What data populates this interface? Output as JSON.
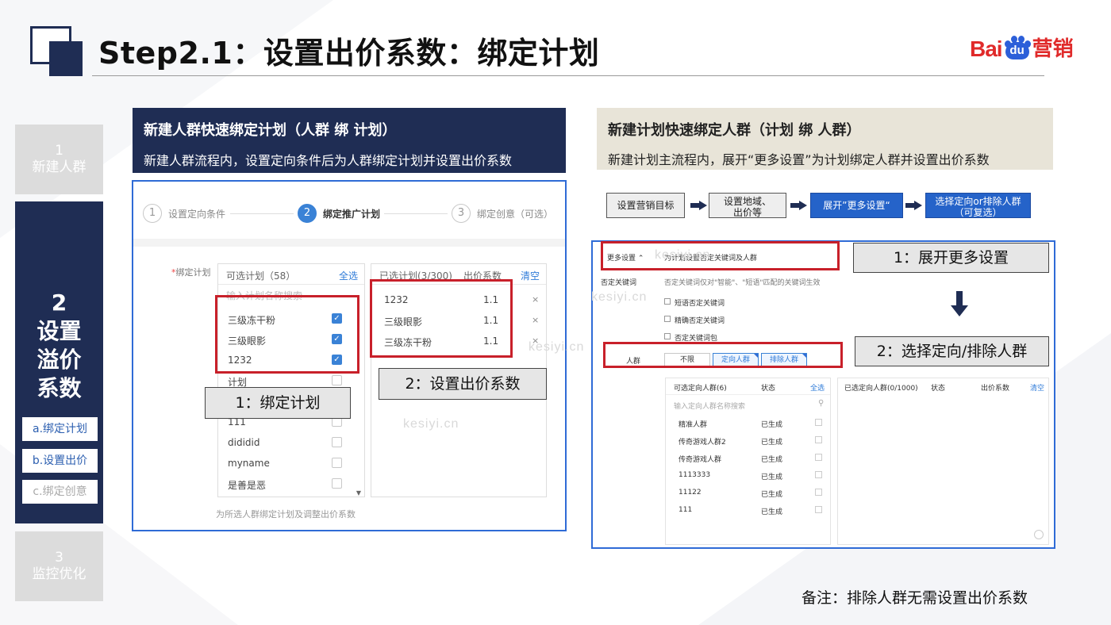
{
  "header": {
    "title": "Step2.1：设置出价系数：绑定计划",
    "logo": {
      "bai": "Bai",
      "du": "du",
      "suffix": "营销"
    }
  },
  "nav": {
    "step1": {
      "num": "1",
      "label": "新建人群"
    },
    "step2": {
      "num": "2",
      "label_lines": [
        "设置",
        "溢价",
        "系数"
      ]
    },
    "step2_sub": [
      "a.绑定计划",
      "b.设置出价",
      "c.绑定创意"
    ],
    "step3": {
      "num": "3",
      "label": "监控优化"
    }
  },
  "left": {
    "header_title": "新建人群快速绑定计划（人群 绑 计划）",
    "header_sub": "新建人群流程内，设置定向条件后为人群绑定计划并设置出价系数",
    "wizard": [
      {
        "num": "1",
        "label": "设置定向条件"
      },
      {
        "num": "2",
        "label": "绑定推广计划"
      },
      {
        "num": "3",
        "label": "绑定创意（可选）"
      }
    ],
    "bind_label_star": "*",
    "bind_label": "绑定计划",
    "available": {
      "title": "可选计划（58）",
      "select_all": "全选",
      "search_placeholder": "输入计划名称搜索",
      "items": [
        "三级冻干粉",
        "三级眼影",
        "1232",
        "计划",
        "111",
        "dididid",
        "myname",
        "是善是恶"
      ]
    },
    "selected": {
      "title": "已选计划(3/300)",
      "coef_header": "出价系数",
      "clear": "清空",
      "items": [
        {
          "name": "1232",
          "coef": "1.1"
        },
        {
          "name": "三级眼影",
          "coef": "1.1"
        },
        {
          "name": "三级冻干粉",
          "coef": "1.1"
        }
      ],
      "remove": "×"
    },
    "footer_note": "为所选人群绑定计划及调整出价系数",
    "callout1": "1：绑定计划",
    "callout2": "2：设置出价系数"
  },
  "right": {
    "header_title": "新建计划快速绑定人群（计划 绑 人群）",
    "header_sub": "新建计划主流程内，展开“更多设置”为计划绑定人群并设置出价系数",
    "flow": [
      {
        "line1": "设置营销目标",
        "line2": ""
      },
      {
        "line1": "设置地域、",
        "line2": "出价等"
      },
      {
        "line1": "展开”更多设置“",
        "line2": ""
      },
      {
        "line1": "选择定向or排除人群",
        "line2": "（可复选）"
      }
    ],
    "more_settings": "更多设置 ⌃",
    "more_desc": "为计划设置否定关键词及人群",
    "neg_kw_label": "否定关键词",
    "neg_kw_desc": "否定关键词仅对\"智能\"、\"短语\"匹配的关键词生效",
    "neg_opts": [
      "短语否定关键词",
      "精确否定关键词",
      "否定关键词包"
    ],
    "crowd_label": "人群",
    "crowd_tabs": [
      "不限",
      "定向人群",
      "排除人群"
    ],
    "avail_title": "可选定向人群(6)",
    "status_header": "状态",
    "select_all": "全选",
    "search_placeholder": "输入定向人群名称搜索",
    "crowds": [
      {
        "name": "精准人群",
        "status": "已生成"
      },
      {
        "name": "传奇游戏人群2",
        "status": "已生成"
      },
      {
        "name": "传奇游戏人群",
        "status": "已生成"
      },
      {
        "name": "1113333",
        "status": "已生成"
      },
      {
        "name": "11122",
        "status": "已生成"
      },
      {
        "name": "111",
        "status": "已生成"
      }
    ],
    "selected_title": "已选定向人群(0/1000)",
    "selected_status": "状态",
    "selected_coef": "出价系数",
    "selected_clear": "清空",
    "callout1": "1：展开更多设置",
    "callout2": "2：选择定向/排除人群"
  },
  "watermark": [
    "kesiyi.cn",
    "kesiyi.cn",
    "kesiyi.cn",
    "kesiyi.cn"
  ],
  "note": "备注：排除人群无需设置出价系数",
  "colors": {
    "navy": "#1f2d54",
    "red": "#c8202a",
    "blue": "#2f6bd6",
    "beige": "#e8e4d8"
  }
}
